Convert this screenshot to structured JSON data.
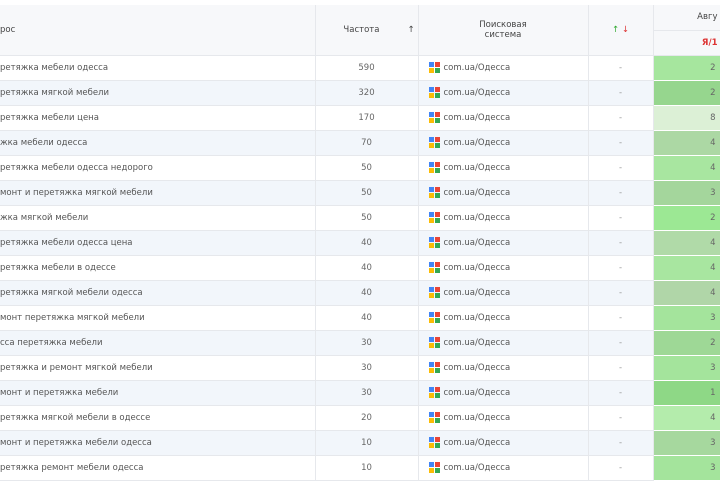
{
  "header": {
    "query": "рос",
    "frequency": "Частота",
    "sort_icon": "↑",
    "engine": "Поисковая система",
    "change_up": "↑",
    "change_down": "↓",
    "period": "Авгу",
    "period_sub_red": "Я",
    "period_sub": "/1"
  },
  "rows": [
    {
      "query": "ретяжка мебели одесса",
      "freq": "590",
      "engine": "com.ua/Одесса",
      "change": "-",
      "pos": "2",
      "color": "#a6e69e"
    },
    {
      "query": "ретяжка мягкой мебели",
      "freq": "320",
      "engine": "com.ua/Одесса",
      "change": "-",
      "pos": "2",
      "color": "#96d68e"
    },
    {
      "query": "ретяжка мебели цена",
      "freq": "170",
      "engine": "com.ua/Одесса",
      "change": "-",
      "pos": "8",
      "color": "#dcf0d6"
    },
    {
      "query": "жка мебели одесса",
      "freq": "70",
      "engine": "com.ua/Одесса",
      "change": "-",
      "pos": "4",
      "color": "#acd8a4"
    },
    {
      "query": "ретяжка мебели одесса недорого",
      "freq": "50",
      "engine": "com.ua/Одесса",
      "change": "-",
      "pos": "4",
      "color": "#a8e6a0"
    },
    {
      "query": "монт и перетяжка мягкой мебели",
      "freq": "50",
      "engine": "com.ua/Одесса",
      "change": "-",
      "pos": "3",
      "color": "#a4d69c"
    },
    {
      "query": "жка мягкой мебели",
      "freq": "50",
      "engine": "com.ua/Одесса",
      "change": "-",
      "pos": "2",
      "color": "#9ce894"
    },
    {
      "query": "ретяжка мебели одесса цена",
      "freq": "40",
      "engine": "com.ua/Одесса",
      "change": "-",
      "pos": "4",
      "color": "#b0daa8"
    },
    {
      "query": "ретяжка мебели в одессе",
      "freq": "40",
      "engine": "com.ua/Одесса",
      "change": "-",
      "pos": "4",
      "color": "#a8e6a0"
    },
    {
      "query": "ретяжка мягкой мебели одесса",
      "freq": "40",
      "engine": "com.ua/Одесса",
      "change": "-",
      "pos": "4",
      "color": "#b0d6a8"
    },
    {
      "query": "монт перетяжка мягкой мебели",
      "freq": "40",
      "engine": "com.ua/Одесса",
      "change": "-",
      "pos": "3",
      "color": "#a4e49c"
    },
    {
      "query": "сса перетяжка мебели",
      "freq": "30",
      "engine": "com.ua/Одесса",
      "change": "-",
      "pos": "2",
      "color": "#9ed896"
    },
    {
      "query": "ретяжка и ремонт мягкой мебели",
      "freq": "30",
      "engine": "com.ua/Одесса",
      "change": "-",
      "pos": "3",
      "color": "#a4e49c"
    },
    {
      "query": "монт и перетяжка мебели",
      "freq": "30",
      "engine": "com.ua/Одесса",
      "change": "-",
      "pos": "1",
      "color": "#8ed886"
    },
    {
      "query": "ретяжка мягкой мебели в одессе",
      "freq": "20",
      "engine": "com.ua/Одесса",
      "change": "-",
      "pos": "4",
      "color": "#b4ecac"
    },
    {
      "query": "монт и перетяжка мебели одесса",
      "freq": "10",
      "engine": "com.ua/Одесса",
      "change": "-",
      "pos": "3",
      "color": "#a6d89e"
    },
    {
      "query": "ретяжка ремонт мебели одесса",
      "freq": "10",
      "engine": "com.ua/Одесса",
      "change": "-",
      "pos": "3",
      "color": "#a4e49c"
    }
  ]
}
